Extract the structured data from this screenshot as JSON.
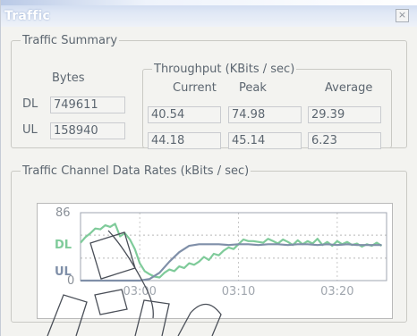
{
  "window": {
    "title": "Traffic",
    "close_glyph": "×"
  },
  "summary": {
    "legend": "Traffic Summary",
    "bytes_header": "Bytes",
    "throughput_legend": "Throughput (KBits / sec)",
    "col_current": "Current",
    "col_peak": "Peak",
    "col_average": "Average",
    "rows": [
      {
        "label": "DL",
        "bytes": "749611",
        "current": "40.54",
        "peak": "74.98",
        "average": "29.39"
      },
      {
        "label": "UL",
        "bytes": "158940",
        "current": "44.18",
        "peak": "45.14",
        "average": "6.23"
      }
    ]
  },
  "rates": {
    "legend": "Traffic Channel Data Rates (kBits / sec)"
  },
  "chart_data": {
    "type": "line",
    "title": "",
    "xlabel": "",
    "ylabel": "",
    "ylim": [
      0,
      86
    ],
    "y_tick_labels": [
      "86",
      "0"
    ],
    "x_tick_labels": [
      "03:00",
      "03:10",
      "03:20"
    ],
    "x_tick_positions": [
      0,
      10,
      20
    ],
    "xlim": [
      -6,
      25
    ],
    "grid": true,
    "series": [
      {
        "name": "DL",
        "color": "#7fcb9a",
        "x": [
          -6,
          -5.5,
          -5,
          -4.5,
          -4,
          -3.5,
          -3,
          -2.5,
          -2,
          -1.5,
          -1,
          -0.5,
          0,
          0.5,
          1,
          1.5,
          2,
          2.5,
          3,
          3.5,
          4,
          4.5,
          5,
          5.5,
          6,
          6.5,
          7,
          7.5,
          8,
          8.5,
          9,
          9.5,
          10,
          10.5,
          11,
          11.5,
          12,
          12.5,
          13,
          13.5,
          14,
          14.5,
          15,
          15.5,
          16,
          16.5,
          17,
          17.5,
          18,
          18.5,
          19,
          19.5,
          20,
          20.5,
          21,
          21.5,
          22,
          22.5,
          23,
          23.5,
          24,
          24.5
        ],
        "values": [
          48,
          55,
          60,
          66,
          65,
          70,
          68,
          72,
          56,
          60,
          52,
          40,
          22,
          12,
          8,
          5,
          4,
          10,
          14,
          12,
          18,
          16,
          22,
          20,
          24,
          30,
          26,
          34,
          32,
          38,
          42,
          40,
          46,
          52,
          50,
          50,
          49,
          48,
          53,
          50,
          47,
          52,
          49,
          45,
          51,
          46,
          50,
          47,
          53,
          45,
          49,
          44,
          50,
          46,
          49,
          45,
          47,
          43,
          46,
          44,
          48,
          44
        ]
      },
      {
        "name": "UL",
        "color": "#7f8fa8",
        "x": [
          -6,
          -5,
          -4,
          -3,
          -2,
          -1,
          0,
          1,
          2,
          3,
          4,
          5,
          6,
          7,
          8,
          9,
          10,
          11,
          12,
          13,
          14,
          15,
          16,
          17,
          18,
          19,
          20,
          21,
          22,
          23,
          24,
          24.5
        ],
        "values": [
          0,
          0,
          0,
          0,
          0,
          0,
          0,
          2,
          10,
          24,
          36,
          44,
          46,
          46,
          46,
          45,
          46,
          46,
          45,
          46,
          46,
          45,
          46,
          46,
          45,
          46,
          45,
          46,
          45,
          45,
          45,
          45
        ]
      }
    ]
  }
}
